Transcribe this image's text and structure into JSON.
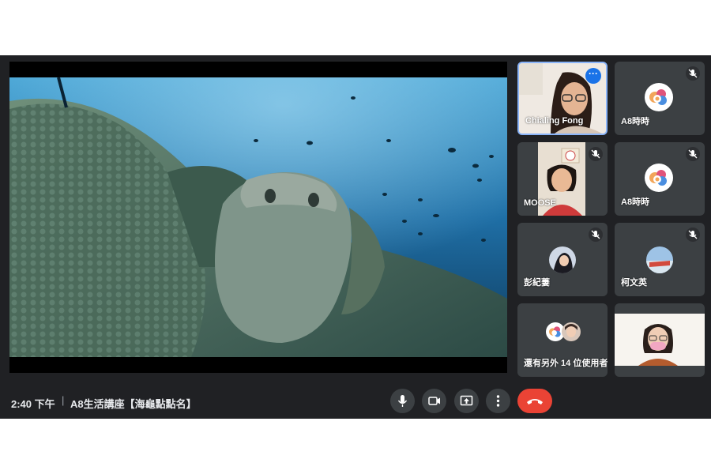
{
  "meeting": {
    "time": "2:40 下午",
    "separator": "|",
    "title": "A8生活講座【海龜點點名】"
  },
  "participants": [
    {
      "name": "Chialing Fong",
      "pinned": true,
      "menu_icon": "more-options-icon"
    },
    {
      "name": "A8時時",
      "muted": true
    },
    {
      "name": "MOOSE",
      "muted": true
    },
    {
      "name": "A8時時",
      "muted": true
    },
    {
      "name": "彭紀萋",
      "muted": true
    },
    {
      "name": "柯文英",
      "muted": true
    },
    {
      "name": "還有另外 14 位使用者"
    }
  ],
  "controls": [
    "microphone-icon",
    "camera-icon",
    "present-screen-icon",
    "more-vert-icon",
    "end-call-icon"
  ],
  "colors": {
    "background": "#202124",
    "tile": "#3c4043",
    "accent": "#8ab4f8",
    "end_call": "#ea4335"
  }
}
